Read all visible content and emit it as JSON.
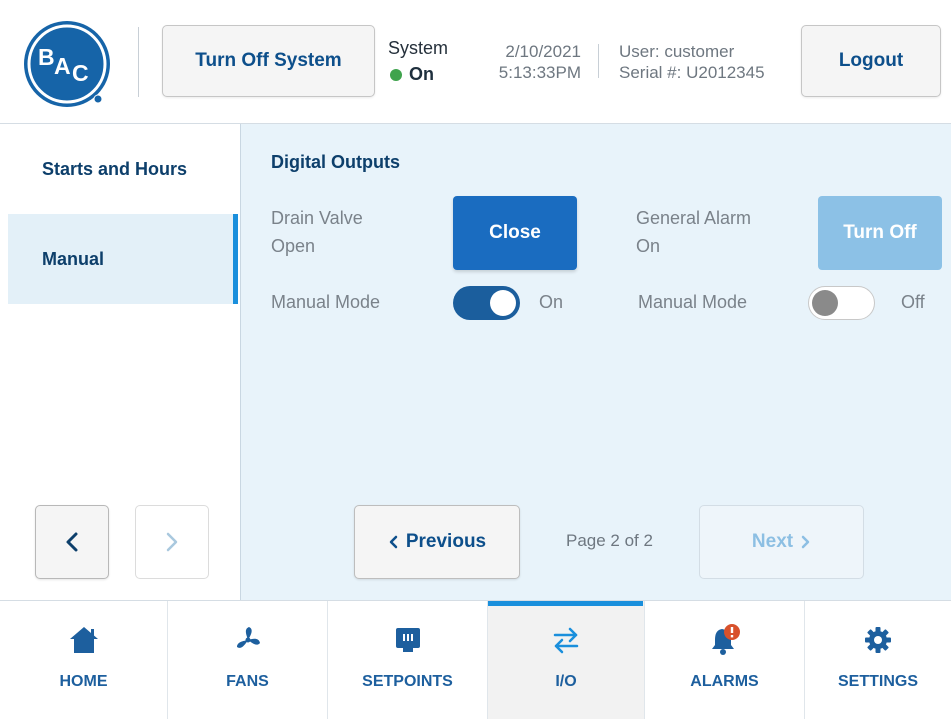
{
  "header": {
    "logo_text": "BAC",
    "turn_off_system_label": "Turn Off System",
    "system_label": "System",
    "system_status": "On",
    "date": "2/10/2021",
    "time": "5:13:33PM",
    "user": "User: customer",
    "serial": "Serial #: U2012345",
    "logout_label": "Logout",
    "colors": {
      "status_dot": "#3fa34d",
      "brand_blue": "#1664a8"
    }
  },
  "sidebar": {
    "items": [
      {
        "label": "Starts and Hours",
        "active": false
      },
      {
        "label": "Manual",
        "active": true
      }
    ],
    "prev_arrow": "chevron-left-icon",
    "next_arrow": "chevron-right-icon"
  },
  "main": {
    "section_title": "Digital Outputs",
    "outputs": [
      {
        "name_line1": "Drain Valve",
        "state_line": "Open",
        "action_label": "Close",
        "manual_mode_label": "Manual Mode",
        "manual_mode_state": "On",
        "action_enabled": true
      },
      {
        "name_line1": "General Alarm",
        "state_line": "On",
        "action_label": "Turn Off",
        "manual_mode_label": "Manual Mode",
        "manual_mode_state": "Off",
        "action_enabled": false
      }
    ],
    "pagination": {
      "previous_label": "Previous",
      "page_info": "Page 2 of 2",
      "next_label": "Next"
    }
  },
  "bottom_nav": {
    "tabs": [
      {
        "label": "HOME",
        "icon": "home-icon"
      },
      {
        "label": "FANS",
        "icon": "fan-icon"
      },
      {
        "label": "SETPOINTS",
        "icon": "setpoints-icon"
      },
      {
        "label": "I/O",
        "icon": "swap-arrows-icon",
        "active": true
      },
      {
        "label": "ALARMS",
        "icon": "bell-alert-icon"
      },
      {
        "label": "SETTINGS",
        "icon": "gear-icon"
      }
    ]
  }
}
